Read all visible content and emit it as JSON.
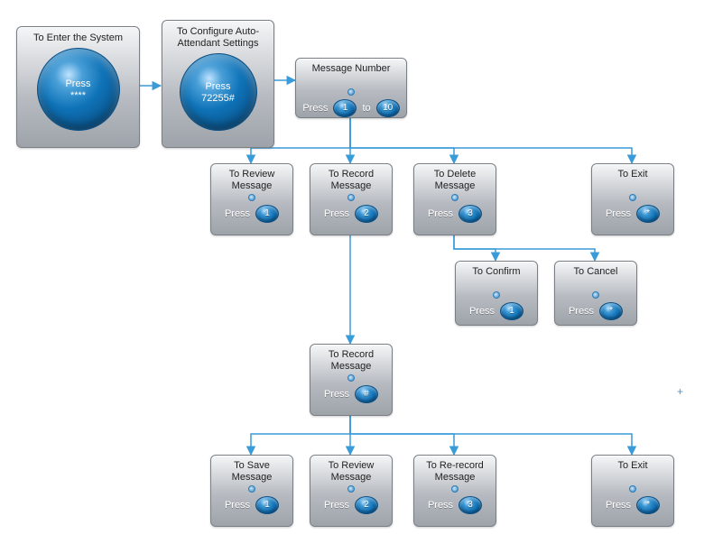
{
  "enter": {
    "title": "To Enter the System",
    "press": "Press",
    "value": "****"
  },
  "config": {
    "title": "To Configure Auto-\nAttendant Settings",
    "press": "Press",
    "value": "72255#"
  },
  "msgnum": {
    "title": "Message Number",
    "press": "Press",
    "from": "1",
    "sep": "to",
    "to": "10"
  },
  "review": {
    "title": "To Review\nMessage",
    "press": "Press",
    "key": "1"
  },
  "record": {
    "title": "To Record\nMessage",
    "press": "Press",
    "key": "2"
  },
  "delete": {
    "title": "To Delete\nMessage",
    "press": "Press",
    "key": "3"
  },
  "exit": {
    "title": "To Exit",
    "press": "Press",
    "key": "*"
  },
  "confirm": {
    "title": "To Confirm",
    "press": "Press",
    "key": "1"
  },
  "cancel": {
    "title": "To Cancel",
    "press": "Press",
    "key": "*"
  },
  "record2": {
    "title": "To Record\nMessage",
    "press": "Press",
    "key": "#"
  },
  "save": {
    "title": "To Save\nMessage",
    "press": "Press",
    "key": "1"
  },
  "review2": {
    "title": "To Review\nMessage",
    "press": "Press",
    "key": "2"
  },
  "rerecord": {
    "title": "To Re-record\nMessage",
    "press": "Press",
    "key": "3"
  },
  "exit2": {
    "title": "To Exit",
    "press": "Press",
    "key": "*"
  }
}
